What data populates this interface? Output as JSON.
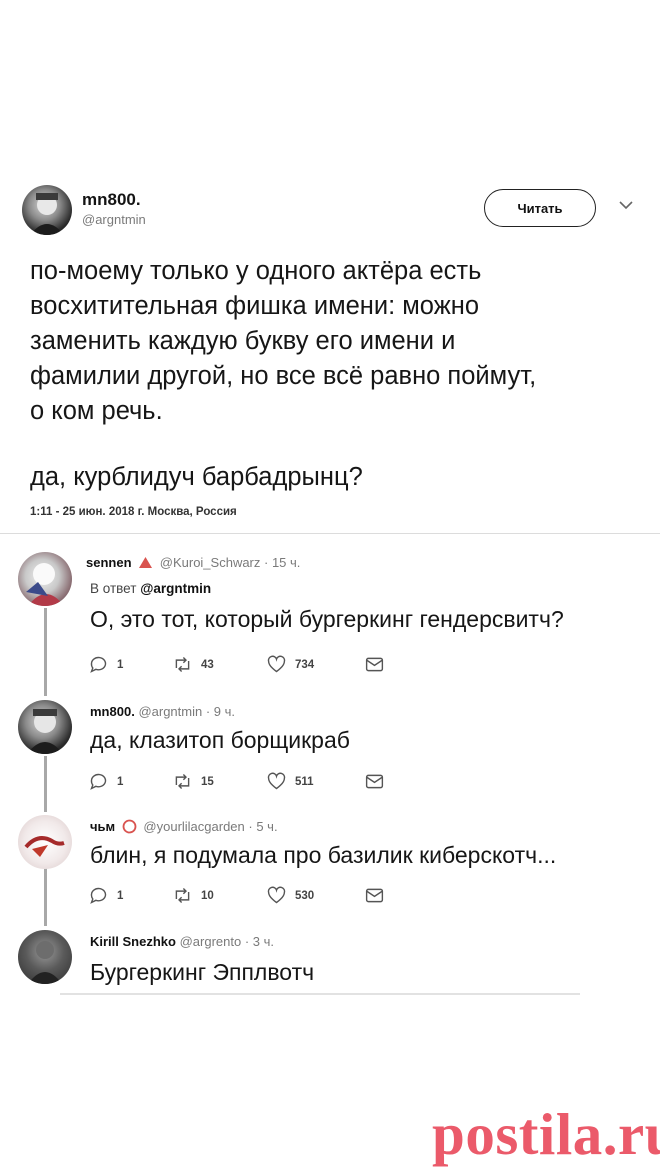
{
  "main_tweet": {
    "display_name": "mn800.",
    "handle": "@argntmin",
    "follow_label": "Читать",
    "chevron": "chevron-down-icon",
    "text": "по-моему только у одного актёра есть\nвосхитительная фишка имени: можно\nзаменить каждую букву его имени и\nфамилии другой, но все всё равно поймут,\nо ком речь.",
    "text2": "да, курблидуч барбадрынц?",
    "meta": "1:11 - 25 июн. 2018 г. Москва, Россия"
  },
  "replies": [
    {
      "display_name": "sennen",
      "badge_icon": "warning-triangle-icon",
      "handle": "@Kuroi_Schwarz",
      "time": "· 15 ч.",
      "reply_to_label": "В ответ",
      "reply_to_handle": "@argntmin",
      "text": "О, это тот, который бургеркинг гендерсвитч?",
      "actions": {
        "replies": "1",
        "retweets": "43",
        "likes": "734"
      }
    },
    {
      "display_name": "mn800.",
      "handle": "@argntmin",
      "time": "· 9 ч.",
      "text": "да, клазитоп борщикраб",
      "actions": {
        "replies": "1",
        "retweets": "15",
        "likes": "511"
      }
    },
    {
      "display_name": "чьм",
      "badge_icon": "circle-icon",
      "handle": "@yourlilacgarden",
      "time": "· 5 ч.",
      "text": "блин, я подумала про базилик киберскотч...",
      "actions": {
        "replies": "1",
        "retweets": "10",
        "likes": "530"
      }
    },
    {
      "display_name": "Kirill Snezhko",
      "handle": "@argrento",
      "time": "· 3 ч.",
      "text": "Бургеркинг Эпплвотч"
    }
  ],
  "watermark": "postila.ru",
  "colors": {
    "watermark": "#eb5a6a",
    "text": "#161616",
    "muted": "#7a7a7a",
    "badge": "#d9534f"
  }
}
